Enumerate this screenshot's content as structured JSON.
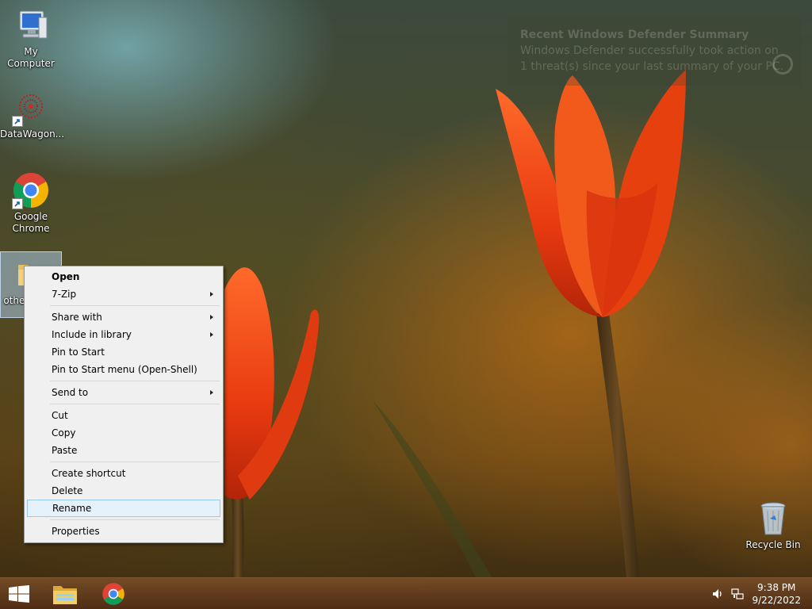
{
  "desktop_icons": [
    {
      "label": "My Computer",
      "icon": "my-computer-icon"
    },
    {
      "label": "DataWagon...",
      "icon": "datawagon-icon"
    },
    {
      "label": "Google Chrome",
      "icon": "chrome-icon"
    },
    {
      "label": "othe… ve…",
      "icon": "folder-icon"
    },
    {
      "label": "Recycle Bin",
      "icon": "recycle-bin-icon"
    }
  ],
  "notification": {
    "title": "Recent Windows Defender Summary",
    "body": "Windows Defender successfully took action on\n1 threat(s) since your last summary of your PC."
  },
  "context_menu": {
    "items": [
      {
        "label": "Open",
        "bold": true
      },
      {
        "label": "7-Zip",
        "submenu": true
      },
      {
        "separator": true
      },
      {
        "label": "Share with",
        "submenu": true
      },
      {
        "label": "Include in library",
        "submenu": true
      },
      {
        "label": "Pin to Start"
      },
      {
        "label": "Pin to Start menu (Open-Shell)"
      },
      {
        "separator": true
      },
      {
        "label": "Send to",
        "submenu": true
      },
      {
        "separator": true
      },
      {
        "label": "Cut"
      },
      {
        "label": "Copy"
      },
      {
        "label": "Paste"
      },
      {
        "separator": true
      },
      {
        "label": "Create shortcut"
      },
      {
        "label": "Delete"
      },
      {
        "label": "Rename",
        "highlighted": true
      },
      {
        "separator": true
      },
      {
        "label": "Properties"
      }
    ]
  },
  "taskbar": {
    "start_icon": "windows-logo-icon",
    "pinned": [
      "file-explorer-icon",
      "chrome-icon"
    ],
    "tray_icons": [
      "speaker-icon",
      "network-icon"
    ],
    "clock": {
      "time": "9:38 PM",
      "date": "9/22/2022"
    }
  },
  "colors": {
    "menu_bg": "#f0f0f0",
    "menu_highlight": "#e5f1fb",
    "menu_highlight_border": "#99c9ef",
    "selection": "#aac8e6"
  }
}
